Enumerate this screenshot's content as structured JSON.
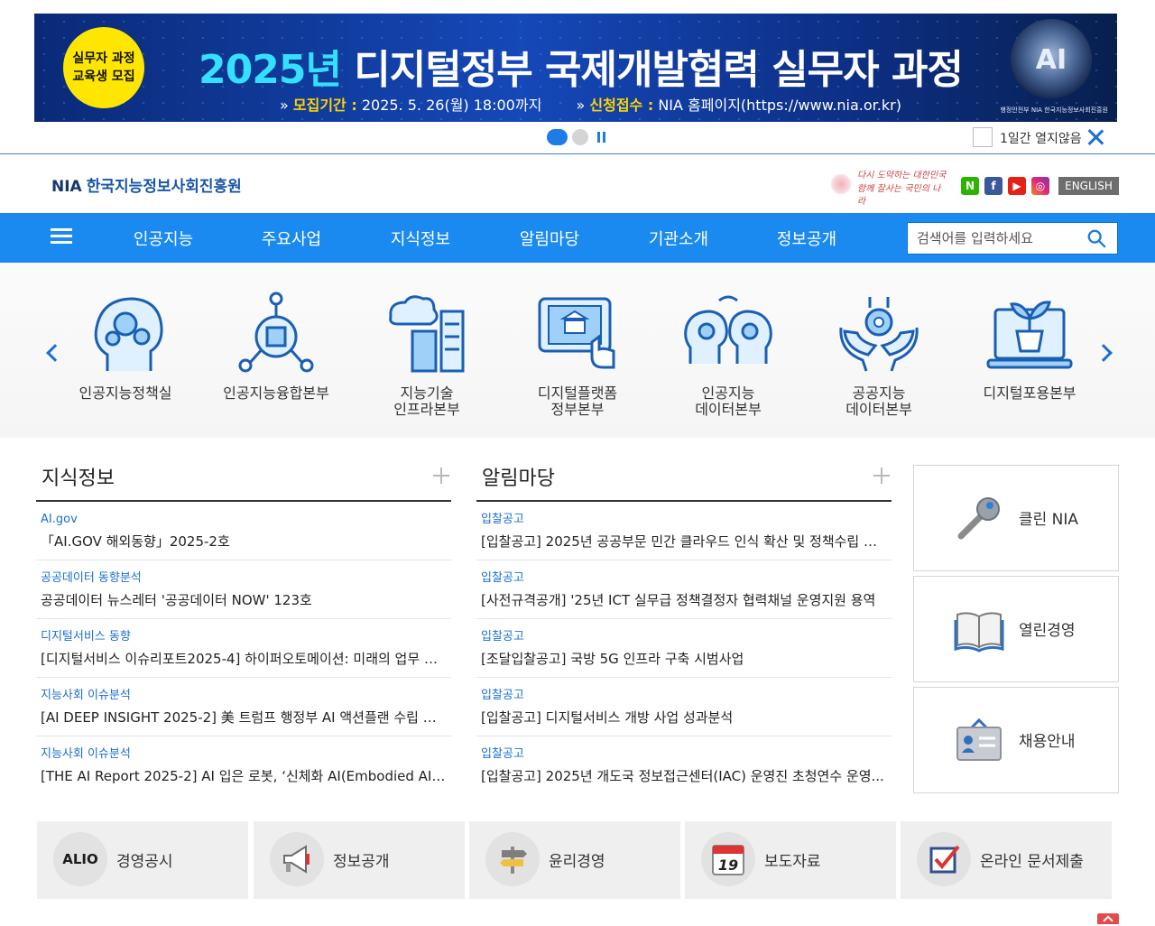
{
  "banner": {
    "badge_line1": "실무자 과정",
    "badge_line2": "교육생 모집",
    "title_year": "2025년",
    "title_rest": "디지털정부 국제개발협력 실무자 과정",
    "period_label": "모집기간 :",
    "period_value": "2025. 5. 26(월) 18:00까지",
    "apply_label": "신청접수 :",
    "apply_value": "NIA 홈페이지(https://www.nia.or.kr)",
    "globe_text": "AI",
    "org_text": "행정안전부  NIA 한국지능정보사회진흥원"
  },
  "banner_controls": {
    "no_show_today": "1일간 열지않음"
  },
  "header": {
    "logo_abbr": "NIA",
    "logo_name": "한국지능정보사회진흥원",
    "slogan_line1": "다시 도약하는 대한민국",
    "slogan_line2": "함께 잘사는 국민의 나라",
    "english": "ENGLISH",
    "sns": [
      "N",
      "f",
      "▶",
      "◎"
    ]
  },
  "nav": {
    "items": [
      "인공지능",
      "주요사업",
      "지식정보",
      "알림마당",
      "기관소개",
      "정보공개"
    ],
    "search_placeholder": "검색어를 입력하세요"
  },
  "quick_links": [
    "인공지능정책실",
    "인공지능융합본부",
    "지능기술\n인프라본부",
    "디지털플랫폼\n정부본부",
    "인공지능\n데이터본부",
    "공공지능\n데이터본부",
    "디지털포용본부"
  ],
  "board_knowledge": {
    "title": "지식정보",
    "items": [
      {
        "cat": "AI.gov",
        "text": "「AI.GOV 해외동향」2025-2호"
      },
      {
        "cat": "공공데이터 동향분석",
        "text": "공공데이터 뉴스레터 '공공데이터 NOW' 123호"
      },
      {
        "cat": "디지털서비스 동향",
        "text": "[디지털서비스 이슈리포트2025-4] 하이퍼오토메이션: 미래의 업무 혁..."
      },
      {
        "cat": "지능사회 이슈분석",
        "text": "[AI DEEP INSIGHT 2025-2] 美 트럼프 행정부 AI 액션플랜 수립 동향(..."
      },
      {
        "cat": "지능사회 이슈분석",
        "text": "[THE AI Report 2025-2] AI 입은 로봇, ‘신체화 AI(Embodied AI)’ 현..."
      }
    ]
  },
  "board_notice": {
    "title": "알림마당",
    "items": [
      {
        "cat": "입찰공고",
        "text": "[입찰공고] 2025년 공공부문 민간 클라우드 인식 확산 및 정책수립 지원"
      },
      {
        "cat": "입찰공고",
        "text": "[사전규격공개] '25년 ICT 실무급 정책결정자 협력채널 운영지원 용역"
      },
      {
        "cat": "입찰공고",
        "text": "[조달입찰공고] 국방 5G 인프라 구축 시범사업"
      },
      {
        "cat": "입찰공고",
        "text": "[입찰공고] 디지털서비스 개방 사업 성과분석"
      },
      {
        "cat": "입찰공고",
        "text": "[입찰공고] 2025년 개도국 정보접근센터(IAC) 운영진 초청연수 운영..."
      }
    ]
  },
  "side_links": [
    "클린 NIA",
    "열린경영",
    "채용안내"
  ],
  "bottom_links": [
    {
      "icon_text": "ALIO",
      "label": "경영공시"
    },
    {
      "icon_text": "",
      "label": "정보공개"
    },
    {
      "icon_text": "",
      "label": "윤리경영"
    },
    {
      "icon_text": "19",
      "label": "보도자료"
    },
    {
      "icon_text": "",
      "label": "온라인 문서제출"
    }
  ],
  "colors": {
    "nav_blue": "#1a8af0",
    "link_blue": "#1a6fd0",
    "banner_yellow": "#ffe600",
    "banner_cyan": "#33e0ff"
  }
}
